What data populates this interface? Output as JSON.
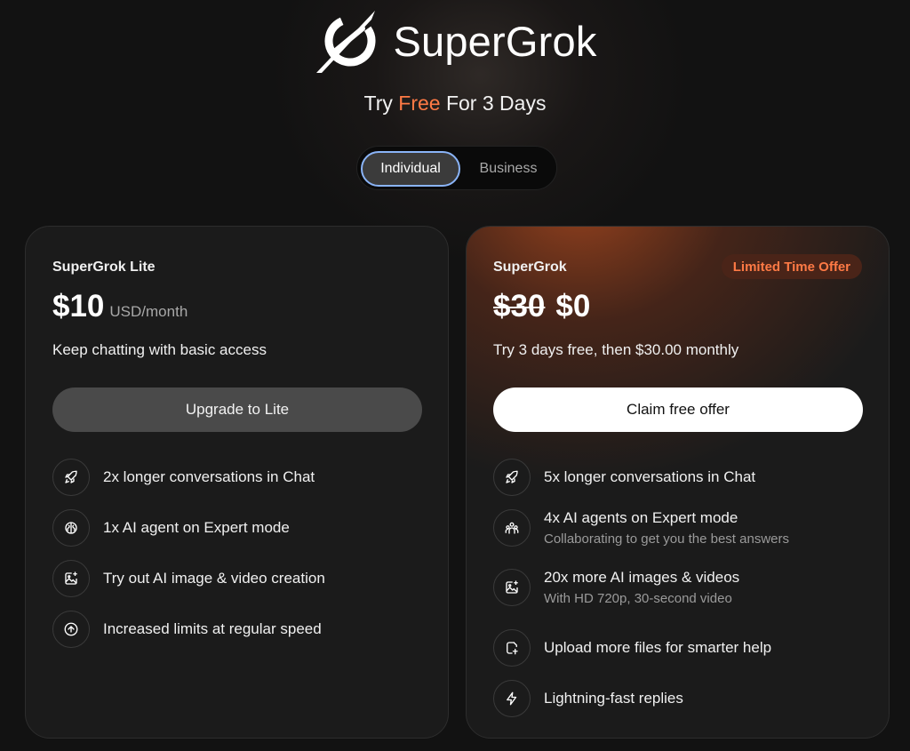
{
  "brand": {
    "name": "SuperGrok"
  },
  "headline": {
    "prefix": "Try ",
    "accent": "Free",
    "suffix": " For 3 Days"
  },
  "toggle": {
    "options": [
      "Individual",
      "Business"
    ],
    "selected": "Individual"
  },
  "plans": [
    {
      "title": "SuperGrok Lite",
      "price": "$10",
      "unit": "USD/month",
      "description": "Keep chatting with basic access",
      "cta": "Upgrade to Lite",
      "features": [
        {
          "icon": "rocket-icon",
          "text": "2x longer conversations in Chat"
        },
        {
          "icon": "brain-icon",
          "text": "1x AI agent on Expert mode"
        },
        {
          "icon": "image-sparkle-icon",
          "text": "Try out AI image & video creation"
        },
        {
          "icon": "arrow-up-circle-icon",
          "text": "Increased limits at regular speed"
        }
      ]
    },
    {
      "title": "SuperGrok",
      "badge": "Limited Time Offer",
      "old_price": "$30",
      "price": "$0",
      "description": "Try 3 days free, then $30.00 monthly",
      "cta": "Claim free offer",
      "features": [
        {
          "icon": "rocket-icon",
          "text": "5x longer conversations in Chat"
        },
        {
          "icon": "people-icon",
          "text": "4x AI agents on Expert mode",
          "sub": "Collaborating to get you the best answers"
        },
        {
          "icon": "image-sparkle-icon",
          "text": "20x more AI images & videos",
          "sub": "With HD 720p, 30-second video"
        },
        {
          "icon": "file-upload-icon",
          "text": "Upload more files for smarter help"
        },
        {
          "icon": "lightning-icon",
          "text": "Lightning-fast replies"
        }
      ]
    }
  ],
  "colors": {
    "accent": "#ff7a45",
    "toggle_ring": "#8ab4f8",
    "badge_bg": "#4a2418"
  }
}
